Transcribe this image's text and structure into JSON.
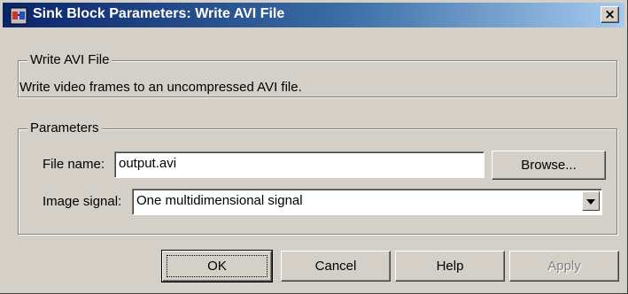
{
  "window": {
    "title": "Sink Block Parameters: Write AVI File",
    "close_glyph": "×",
    "title_color_start": "#0a246a",
    "title_color_end": "#a6caf0"
  },
  "description_group": {
    "legend": "Write AVI File",
    "text": "Write video frames to an uncompressed AVI file."
  },
  "parameters_group": {
    "legend": "Parameters",
    "file_name_label": "File name:",
    "file_name_value": "output.avi",
    "browse_label": "Browse...",
    "image_signal_label": "Image signal:",
    "image_signal_value": "One multidimensional signal"
  },
  "buttons": {
    "ok": "OK",
    "cancel": "Cancel",
    "help": "Help",
    "apply": "Apply"
  },
  "icons": {
    "app": "simulink-block-icon",
    "close": "close-icon",
    "dropdown": "chevron-down-icon"
  }
}
